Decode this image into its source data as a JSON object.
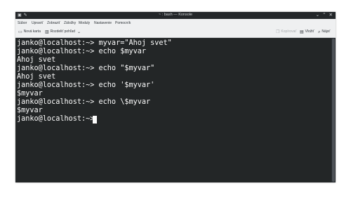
{
  "window": {
    "title": "~ : bash — Konsole"
  },
  "menu": {
    "items": [
      "Súbor",
      "Upraviť",
      "Zobraziť",
      "Záložky",
      "Moduly",
      "Nastavenie",
      "Pomocník"
    ]
  },
  "toolbar": {
    "new_tab": "Nová karta",
    "split_view": "Rozdeliť pohľad",
    "copy": "Kopírovať",
    "paste": "Vložiť",
    "find": "Nájsť"
  },
  "terminal": {
    "lines": [
      "janko@localhost:~> myvar=\"Ahoj svet\"",
      "janko@localhost:~> echo $myvar",
      "Ahoj svet",
      "janko@localhost:~> echo \"$myvar\"",
      "Ahoj svet",
      "janko@localhost:~> echo '$myvar'",
      "$myvar",
      "janko@localhost:~> echo \\$myvar",
      "$myvar",
      "janko@localhost:~> "
    ]
  },
  "colors": {
    "terminal_bg": "#232627",
    "terminal_fg": "#fcfcfc",
    "titlebar_bg": "#232629",
    "chrome_bg": "#eff0f1"
  }
}
